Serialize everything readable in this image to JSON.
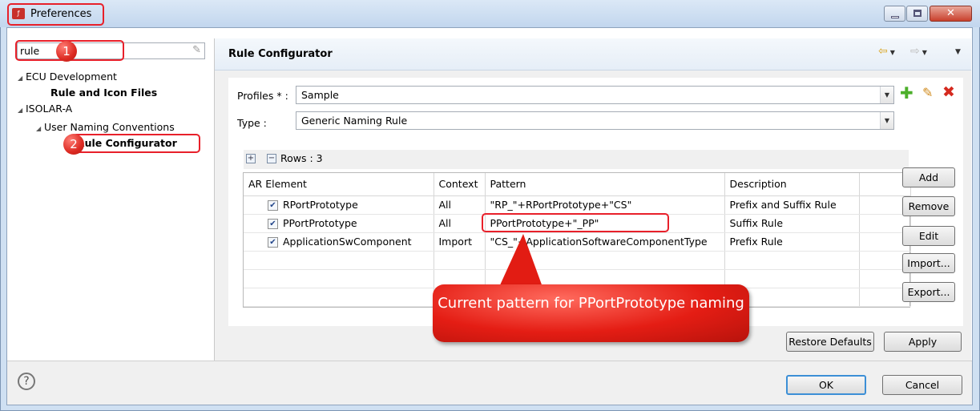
{
  "window": {
    "title": "Preferences",
    "title_icon": "app-icon"
  },
  "search": {
    "value": "rule"
  },
  "tree": [
    {
      "label": "ECU Development",
      "level": 0
    },
    {
      "label": "Rule and Icon Files",
      "level": 1
    },
    {
      "label": "ISOLAR-A",
      "level": 0
    },
    {
      "label": "User Naming Conventions",
      "level": 1
    },
    {
      "label": "Rule Configurator",
      "level": 2
    }
  ],
  "page": {
    "title": "Rule Configurator"
  },
  "form": {
    "profiles_label": "Profiles * :",
    "profiles_value": "Sample",
    "type_label": "Type :",
    "type_value": "Generic Naming Rule"
  },
  "rows": {
    "label": "Rows : 3"
  },
  "table": {
    "headers": [
      "AR Element",
      "Context",
      "Pattern",
      "Description"
    ],
    "rows": [
      {
        "element": "RPortPrototype",
        "context": "All",
        "pattern": "\"RP_\"+RPortPrototype+\"CS\"",
        "description": "Prefix  and Suffix Rule",
        "checked": true
      },
      {
        "element": "PPortPrototype",
        "context": "All",
        "pattern": "PPortPrototype+\"_PP\"",
        "description": "Suffix Rule",
        "checked": true
      },
      {
        "element": "ApplicationSwComponent",
        "context": "Import",
        "pattern": "\"CS_\"+ApplicationSoftwareComponentType",
        "description": "Prefix Rule",
        "checked": true
      }
    ]
  },
  "side_buttons": {
    "add": "Add",
    "remove": "Remove",
    "edit": "Edit",
    "import": "Import...",
    "export": "Export..."
  },
  "footer": {
    "restore_defaults": "Restore Defaults",
    "apply": "Apply",
    "ok": "OK",
    "cancel": "Cancel"
  },
  "annotations": {
    "badge1": "1",
    "badge2": "2",
    "callout": "Current pattern for PPortPrototype naming"
  },
  "colors": {
    "annotation_red": "#e8202a",
    "frame_blue": "#cfe0f2"
  }
}
